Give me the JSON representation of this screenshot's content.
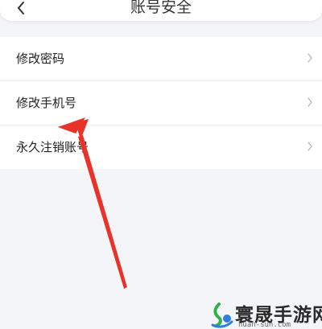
{
  "header": {
    "title": "账号安全",
    "back_icon": "chevron-left-icon"
  },
  "menu": {
    "items": [
      {
        "label": "修改密码",
        "icon": "chevron-right-icon"
      },
      {
        "label": "修改手机号",
        "icon": "chevron-right-icon"
      },
      {
        "label": "永久注销账号",
        "icon": "chevron-right-icon"
      }
    ]
  },
  "annotation": {
    "color": "#e8332a"
  },
  "watermark": {
    "name": "寰晟手游网",
    "domain": "huan-sun.com",
    "colors": {
      "green": "#2fb24c",
      "blue": "#2e7de0"
    }
  }
}
